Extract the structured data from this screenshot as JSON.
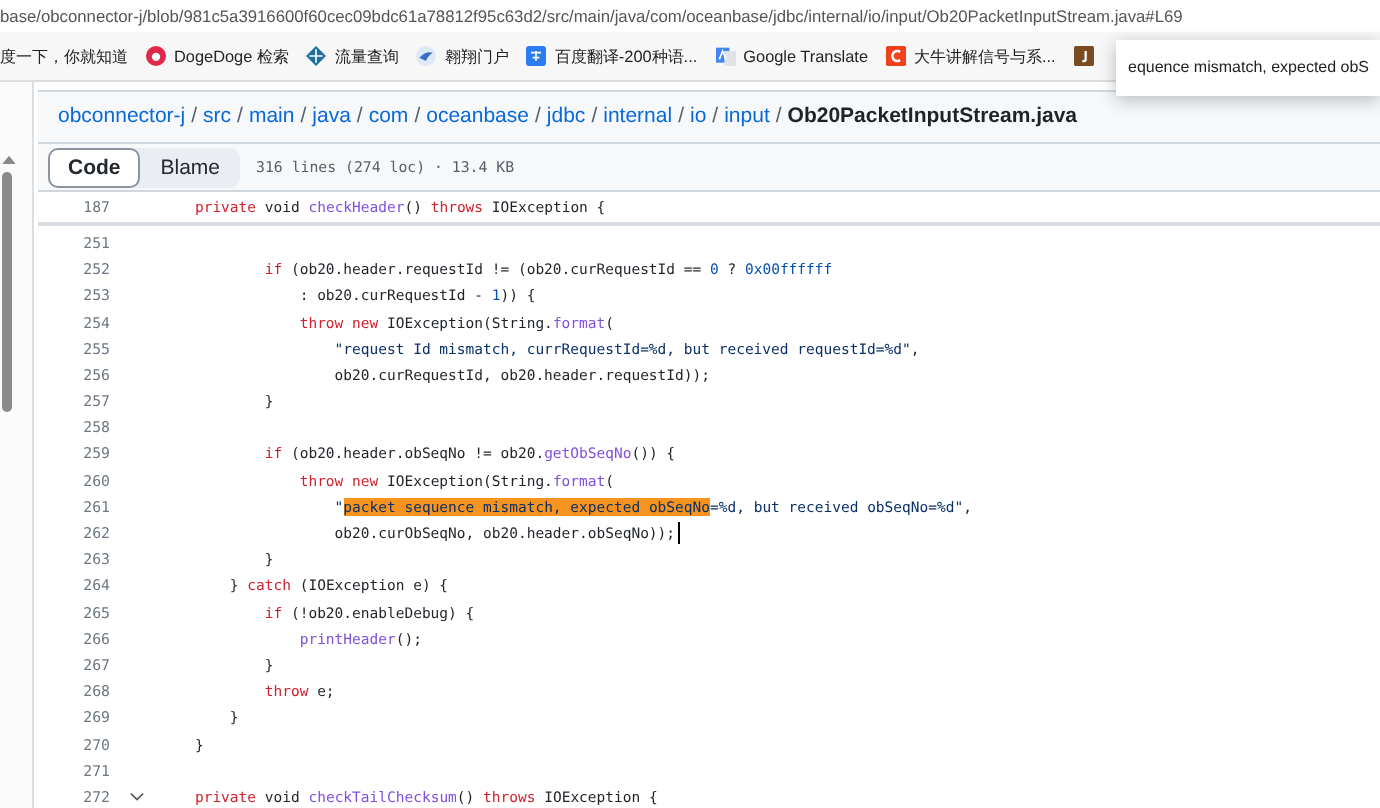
{
  "address_bar": {
    "url": "base/obconnector-j/blob/981c5a3916600f60cec09bdc61a78812f95c63d2/src/main/java/com/oceanbase/jdbc/internal/io/input/Ob20PacketInputStream.java#L69"
  },
  "bookmarks": [
    {
      "label": "度一下，你就知道",
      "kind": "plain"
    },
    {
      "label": "DogeDoge 检索",
      "kind": "doge"
    },
    {
      "label": "流量查询",
      "kind": "diamond"
    },
    {
      "label": "翱翔门户",
      "kind": "bird"
    },
    {
      "label": "百度翻译-200种语...",
      "kind": "translate"
    },
    {
      "label": "Google Translate",
      "kind": "google"
    },
    {
      "label": "大牛讲解信号与系...",
      "kind": "letter"
    },
    {
      "kind": "book"
    }
  ],
  "find_popup": {
    "text": "equence mismatch, expected obS"
  },
  "breadcrumb": {
    "separator": "/",
    "items": [
      {
        "label": "obconnector-j",
        "current": false
      },
      {
        "label": "src",
        "current": false
      },
      {
        "label": "main",
        "current": false
      },
      {
        "label": "java",
        "current": false
      },
      {
        "label": "com",
        "current": false
      },
      {
        "label": "oceanbase",
        "current": false
      },
      {
        "label": "jdbc",
        "current": false
      },
      {
        "label": "internal",
        "current": false
      },
      {
        "label": "io",
        "current": false
      },
      {
        "label": "input",
        "current": false
      },
      {
        "label": "Ob20PacketInputStream.java",
        "current": true
      }
    ]
  },
  "tabs": [
    {
      "label": "Code",
      "selected": true
    },
    {
      "label": "Blame",
      "selected": false
    }
  ],
  "file_info": "316 lines (274 loc) · 13.4 KB",
  "sticky_line": {
    "number": "187",
    "tokens": [
      {
        "kind": "keyword",
        "text": "    private"
      },
      {
        "kind": "plain",
        "text": " void "
      },
      {
        "kind": "function",
        "text": "checkHeader"
      },
      {
        "kind": "plain",
        "text": "() "
      },
      {
        "kind": "keyword",
        "text": "throws"
      },
      {
        "kind": "plain",
        "text": " IOException {"
      }
    ]
  },
  "lines": [
    {
      "number": "251"
    },
    {
      "number": "252",
      "tokens": [
        {
          "kind": "keyword",
          "text": "            if"
        },
        {
          "kind": "plain",
          "text": " (ob20.header.requestId != (ob20.curRequestId == "
        },
        {
          "kind": "number",
          "text": "0"
        },
        {
          "kind": "plain",
          "text": " ? "
        },
        {
          "kind": "number",
          "text": "0x00ffffff"
        }
      ]
    },
    {
      "number": "253",
      "tokens": [
        {
          "kind": "plain",
          "text": "                : ob20.curRequestId - "
        },
        {
          "kind": "number",
          "text": "1"
        },
        {
          "kind": "plain",
          "text": ")) {"
        }
      ]
    },
    {
      "number": "254",
      "tokens": [
        {
          "kind": "keyword",
          "text": "                throw new"
        },
        {
          "kind": "plain",
          "text": " IOException(String."
        },
        {
          "kind": "function",
          "text": "format"
        },
        {
          "kind": "plain",
          "text": "("
        }
      ]
    },
    {
      "number": "255",
      "tokens": [
        {
          "kind": "string",
          "text": "                    \"request Id mismatch, currRequestId=%d, but received requestId=%d\""
        },
        {
          "kind": "plain",
          "text": ","
        }
      ]
    },
    {
      "number": "256",
      "tokens": [
        {
          "kind": "plain",
          "text": "                    ob20.curRequestId, ob20.header.requestId));"
        }
      ]
    },
    {
      "number": "257",
      "tokens": [
        {
          "kind": "plain",
          "text": "            }"
        }
      ]
    },
    {
      "number": "258"
    },
    {
      "number": "259",
      "tokens": [
        {
          "kind": "keyword",
          "text": "            if"
        },
        {
          "kind": "plain",
          "text": " (ob20.header.obSeqNo != ob20."
        },
        {
          "kind": "function",
          "text": "getObSeqNo"
        },
        {
          "kind": "plain",
          "text": "()) {"
        }
      ]
    },
    {
      "number": "260",
      "tokens": [
        {
          "kind": "keyword",
          "text": "                throw new"
        },
        {
          "kind": "plain",
          "text": " IOException(String."
        },
        {
          "kind": "function",
          "text": "format"
        },
        {
          "kind": "plain",
          "text": "("
        }
      ]
    },
    {
      "number": "261",
      "tokens": [
        {
          "kind": "string",
          "text": "                    \""
        },
        {
          "kind": "highlight",
          "text": "packet sequence mismatch, expected obSeqNo"
        },
        {
          "kind": "string",
          "text": "=%d, but received obSeqNo=%d\""
        },
        {
          "kind": "plain",
          "text": ","
        }
      ]
    },
    {
      "number": "262",
      "tokens": [
        {
          "kind": "plain",
          "text": "                    ob20.curObSeqNo, ob20.header.obSeqNo));"
        }
      ],
      "cursor": true
    },
    {
      "number": "263",
      "tokens": [
        {
          "kind": "plain",
          "text": "            }"
        }
      ]
    },
    {
      "number": "264",
      "tokens": [
        {
          "kind": "plain",
          "text": "        } "
        },
        {
          "kind": "keyword",
          "text": "catch"
        },
        {
          "kind": "plain",
          "text": " (IOException e) {"
        }
      ]
    },
    {
      "number": "265",
      "tokens": [
        {
          "kind": "keyword",
          "text": "            if"
        },
        {
          "kind": "plain",
          "text": " (!ob20.enableDebug) {"
        }
      ]
    },
    {
      "number": "266",
      "tokens": [
        {
          "kind": "function",
          "text": "                printHeader"
        },
        {
          "kind": "plain",
          "text": "();"
        }
      ]
    },
    {
      "number": "267",
      "tokens": [
        {
          "kind": "plain",
          "text": "            }"
        }
      ]
    },
    {
      "number": "268",
      "tokens": [
        {
          "kind": "keyword",
          "text": "            throw"
        },
        {
          "kind": "plain",
          "text": " e;"
        }
      ]
    },
    {
      "number": "269",
      "tokens": [
        {
          "kind": "plain",
          "text": "        }"
        }
      ]
    },
    {
      "number": "270",
      "tokens": [
        {
          "kind": "plain",
          "text": "    }"
        }
      ]
    },
    {
      "number": "271"
    },
    {
      "number": "272",
      "tokens": [
        {
          "kind": "keyword",
          "text": "    private"
        },
        {
          "kind": "plain",
          "text": " void "
        },
        {
          "kind": "function",
          "text": "checkTailChecksum"
        },
        {
          "kind": "plain",
          "text": "() "
        },
        {
          "kind": "keyword",
          "text": "throws"
        },
        {
          "kind": "plain",
          "text": " IOException {"
        }
      ],
      "foldable": true
    }
  ]
}
